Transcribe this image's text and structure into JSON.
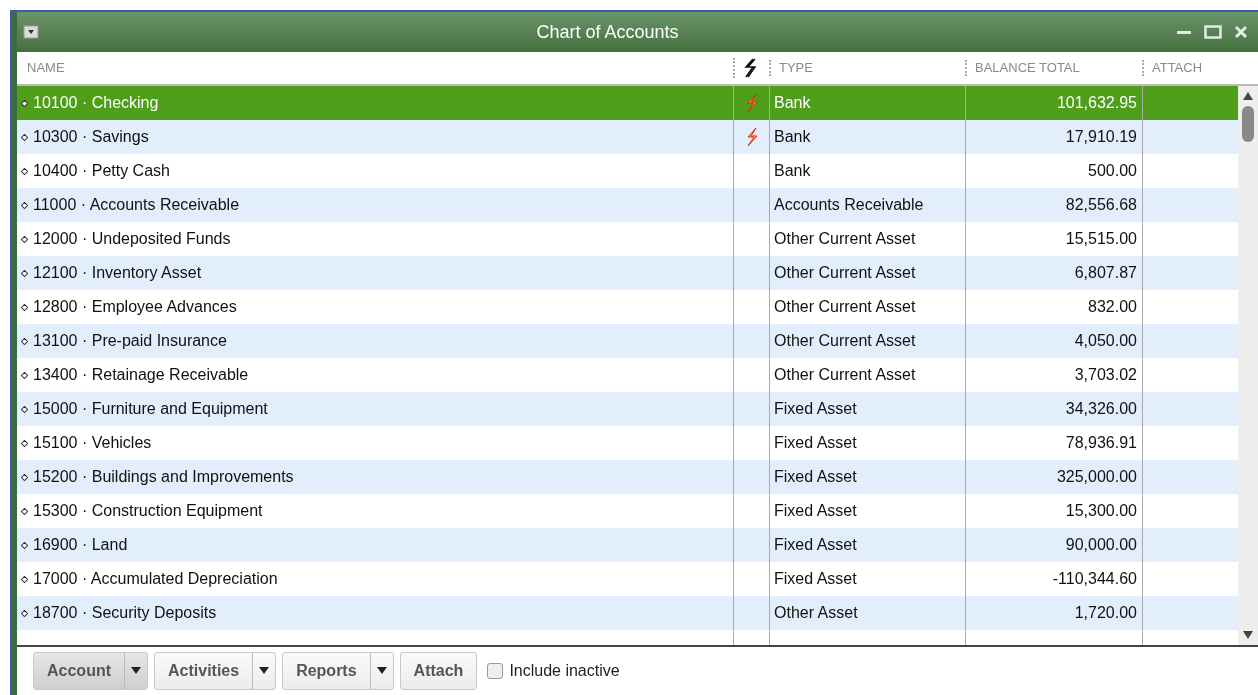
{
  "window": {
    "title": "Chart of Accounts"
  },
  "table": {
    "columns": [
      {
        "kind": "text",
        "label": "NAME"
      },
      {
        "kind": "icon"
      },
      {
        "kind": "text",
        "label": "TYPE"
      },
      {
        "kind": "text",
        "label": "BALANCE TOTAL"
      },
      {
        "kind": "text",
        "label": "ATTACH"
      }
    ],
    "rows": [
      {
        "name": "10100 · Checking",
        "online": true,
        "type": "Bank",
        "balance": "101,632.95",
        "selected": true
      },
      {
        "name": "10300 · Savings",
        "online": true,
        "type": "Bank",
        "balance": "17,910.19",
        "selected": false
      },
      {
        "name": "10400 · Petty Cash",
        "online": false,
        "type": "Bank",
        "balance": "500.00",
        "selected": false
      },
      {
        "name": "11000 · Accounts Receivable",
        "online": false,
        "type": "Accounts Receivable",
        "balance": "82,556.68",
        "selected": false
      },
      {
        "name": "12000 · Undeposited Funds",
        "online": false,
        "type": "Other Current Asset",
        "balance": "15,515.00",
        "selected": false
      },
      {
        "name": "12100 · Inventory Asset",
        "online": false,
        "type": "Other Current Asset",
        "balance": "6,807.87",
        "selected": false
      },
      {
        "name": "12800 · Employee Advances",
        "online": false,
        "type": "Other Current Asset",
        "balance": "832.00",
        "selected": false
      },
      {
        "name": "13100 · Pre-paid Insurance",
        "online": false,
        "type": "Other Current Asset",
        "balance": "4,050.00",
        "selected": false
      },
      {
        "name": "13400 · Retainage Receivable",
        "online": false,
        "type": "Other Current Asset",
        "balance": "3,703.02",
        "selected": false
      },
      {
        "name": "15000 · Furniture and Equipment",
        "online": false,
        "type": "Fixed Asset",
        "balance": "34,326.00",
        "selected": false
      },
      {
        "name": "15100 · Vehicles",
        "online": false,
        "type": "Fixed Asset",
        "balance": "78,936.91",
        "selected": false
      },
      {
        "name": "15200 · Buildings and Improvements",
        "online": false,
        "type": "Fixed Asset",
        "balance": "325,000.00",
        "selected": false
      },
      {
        "name": "15300 · Construction Equipment",
        "online": false,
        "type": "Fixed Asset",
        "balance": "15,300.00",
        "selected": false
      },
      {
        "name": "16900 · Land",
        "online": false,
        "type": "Fixed Asset",
        "balance": "90,000.00",
        "selected": false
      },
      {
        "name": "17000 · Accumulated Depreciation",
        "online": false,
        "type": "Fixed Asset",
        "balance": "-110,344.60",
        "selected": false
      },
      {
        "name": "18700 · Security Deposits",
        "online": false,
        "type": "Other Asset",
        "balance": "1,720.00",
        "selected": false
      }
    ]
  },
  "toolbar": {
    "buttons": [
      {
        "label": "Account",
        "dropdown": true,
        "pressed": true
      },
      {
        "label": "Activities",
        "dropdown": true,
        "pressed": false
      },
      {
        "label": "Reports",
        "dropdown": true,
        "pressed": false
      },
      {
        "label": "Attach",
        "dropdown": false,
        "pressed": false
      }
    ],
    "include_inactive": {
      "label": "Include inactive",
      "checked": false
    }
  }
}
